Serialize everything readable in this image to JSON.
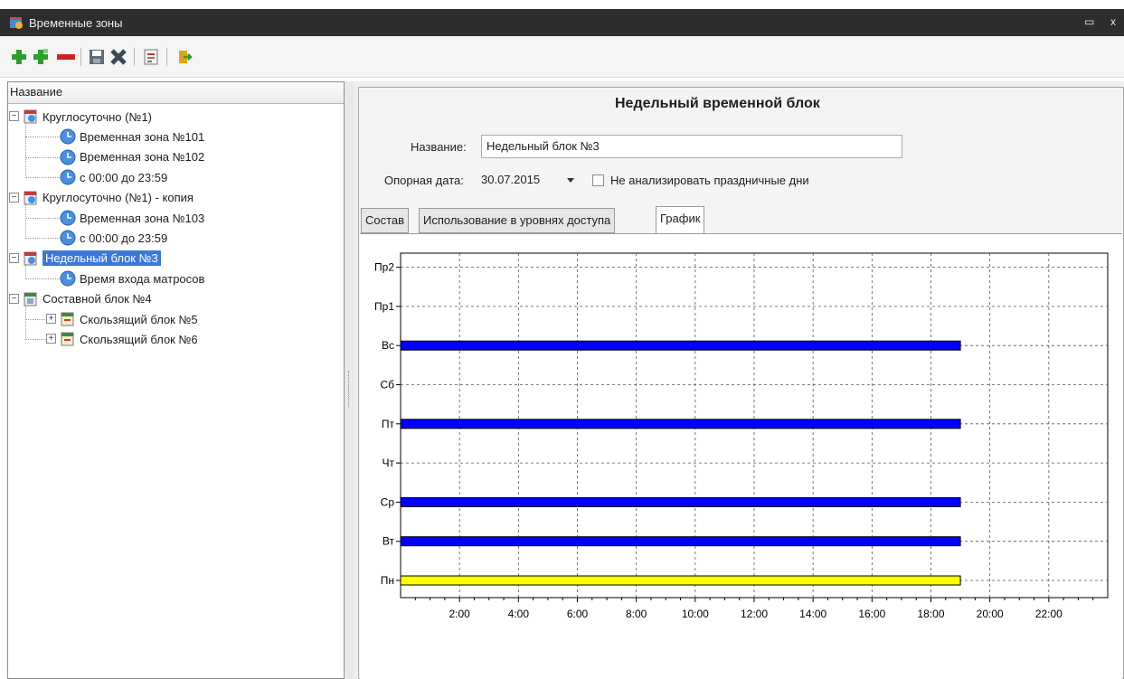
{
  "window": {
    "title": "Временные зоны",
    "maximize_glyph": "▭",
    "close_glyph": "x"
  },
  "toolbar": {
    "buttons": [
      {
        "name": "add-icon",
        "color": "#2e9d2e"
      },
      {
        "name": "add-child-icon",
        "color": "#2e9d2e"
      },
      {
        "name": "delete-icon",
        "color": "#d21f1f"
      },
      {
        "name": "save-icon",
        "color": "#5c6b7a"
      },
      {
        "name": "cancel-icon",
        "color": "#3e4a57"
      },
      {
        "name": "report-icon",
        "color": "#7a7a7a"
      },
      {
        "name": "export-icon",
        "color": "#e3a21a"
      }
    ]
  },
  "tree": {
    "header": "Название",
    "items": [
      {
        "label": "Круглосуточно (№1)",
        "level": 0,
        "type": "group",
        "expander": "−"
      },
      {
        "label": "Временная зона №101",
        "level": 1,
        "type": "zone"
      },
      {
        "label": "Временная зона №102",
        "level": 1,
        "type": "zone"
      },
      {
        "label": "с 00:00 до 23:59",
        "level": 1,
        "type": "zone"
      },
      {
        "label": "Круглосуточно (№1) - копия",
        "level": 0,
        "type": "group",
        "expander": "−"
      },
      {
        "label": "Временная зона №103",
        "level": 1,
        "type": "zone"
      },
      {
        "label": "с 00:00 до 23:59",
        "level": 1,
        "type": "zone"
      },
      {
        "label": "Недельный блок №3",
        "level": 0,
        "type": "group",
        "expander": "−",
        "selected": true
      },
      {
        "label": "Время входа матросов",
        "level": 1,
        "type": "zone"
      },
      {
        "label": "Составной блок №4",
        "level": 0,
        "type": "composite",
        "expander": "−"
      },
      {
        "label": "Скользящий блок №5",
        "level": 1,
        "type": "sliding",
        "expander": "+"
      },
      {
        "label": "Скользящий блок №6",
        "level": 1,
        "type": "sliding",
        "expander": "+"
      }
    ]
  },
  "detail": {
    "title": "Недельный временной блок",
    "name_label": "Название:",
    "name_value": "Недельный блок №3",
    "date_label": "Опорная дата:",
    "date_value": "30.07.2015",
    "holiday_checkbox_label": "Не анализировать праздничные дни",
    "holiday_checked": false,
    "tabs": [
      {
        "label": "Состав",
        "active": false
      },
      {
        "label": "Использование в уровнях доступа",
        "active": false
      },
      {
        "label": "График",
        "active": true
      }
    ]
  },
  "chart_data": {
    "type": "bar",
    "orientation": "horizontal",
    "categories": [
      "Пн",
      "Вт",
      "Ср",
      "Чт",
      "Пт",
      "Сб",
      "Вс",
      "Пр1",
      "Пр2"
    ],
    "x_tick_labels": [
      "2:00",
      "4:00",
      "6:00",
      "8:00",
      "10:00",
      "12:00",
      "14:00",
      "16:00",
      "18:00",
      "20:00",
      "22:00"
    ],
    "x_ticks_hours": [
      2,
      4,
      6,
      8,
      10,
      12,
      14,
      16,
      18,
      20,
      22
    ],
    "xlim": [
      0,
      24
    ],
    "grid": true,
    "bars": [
      {
        "category": "Пн",
        "start": 0,
        "end": 19,
        "color": "#ffff00"
      },
      {
        "category": "Вт",
        "start": 0,
        "end": 19,
        "color": "#0000ff"
      },
      {
        "category": "Ср",
        "start": 0,
        "end": 19,
        "color": "#0000ff"
      },
      {
        "category": "Пт",
        "start": 0,
        "end": 19,
        "color": "#0000ff"
      },
      {
        "category": "Вс",
        "start": 0,
        "end": 19,
        "color": "#0000ff"
      }
    ]
  }
}
